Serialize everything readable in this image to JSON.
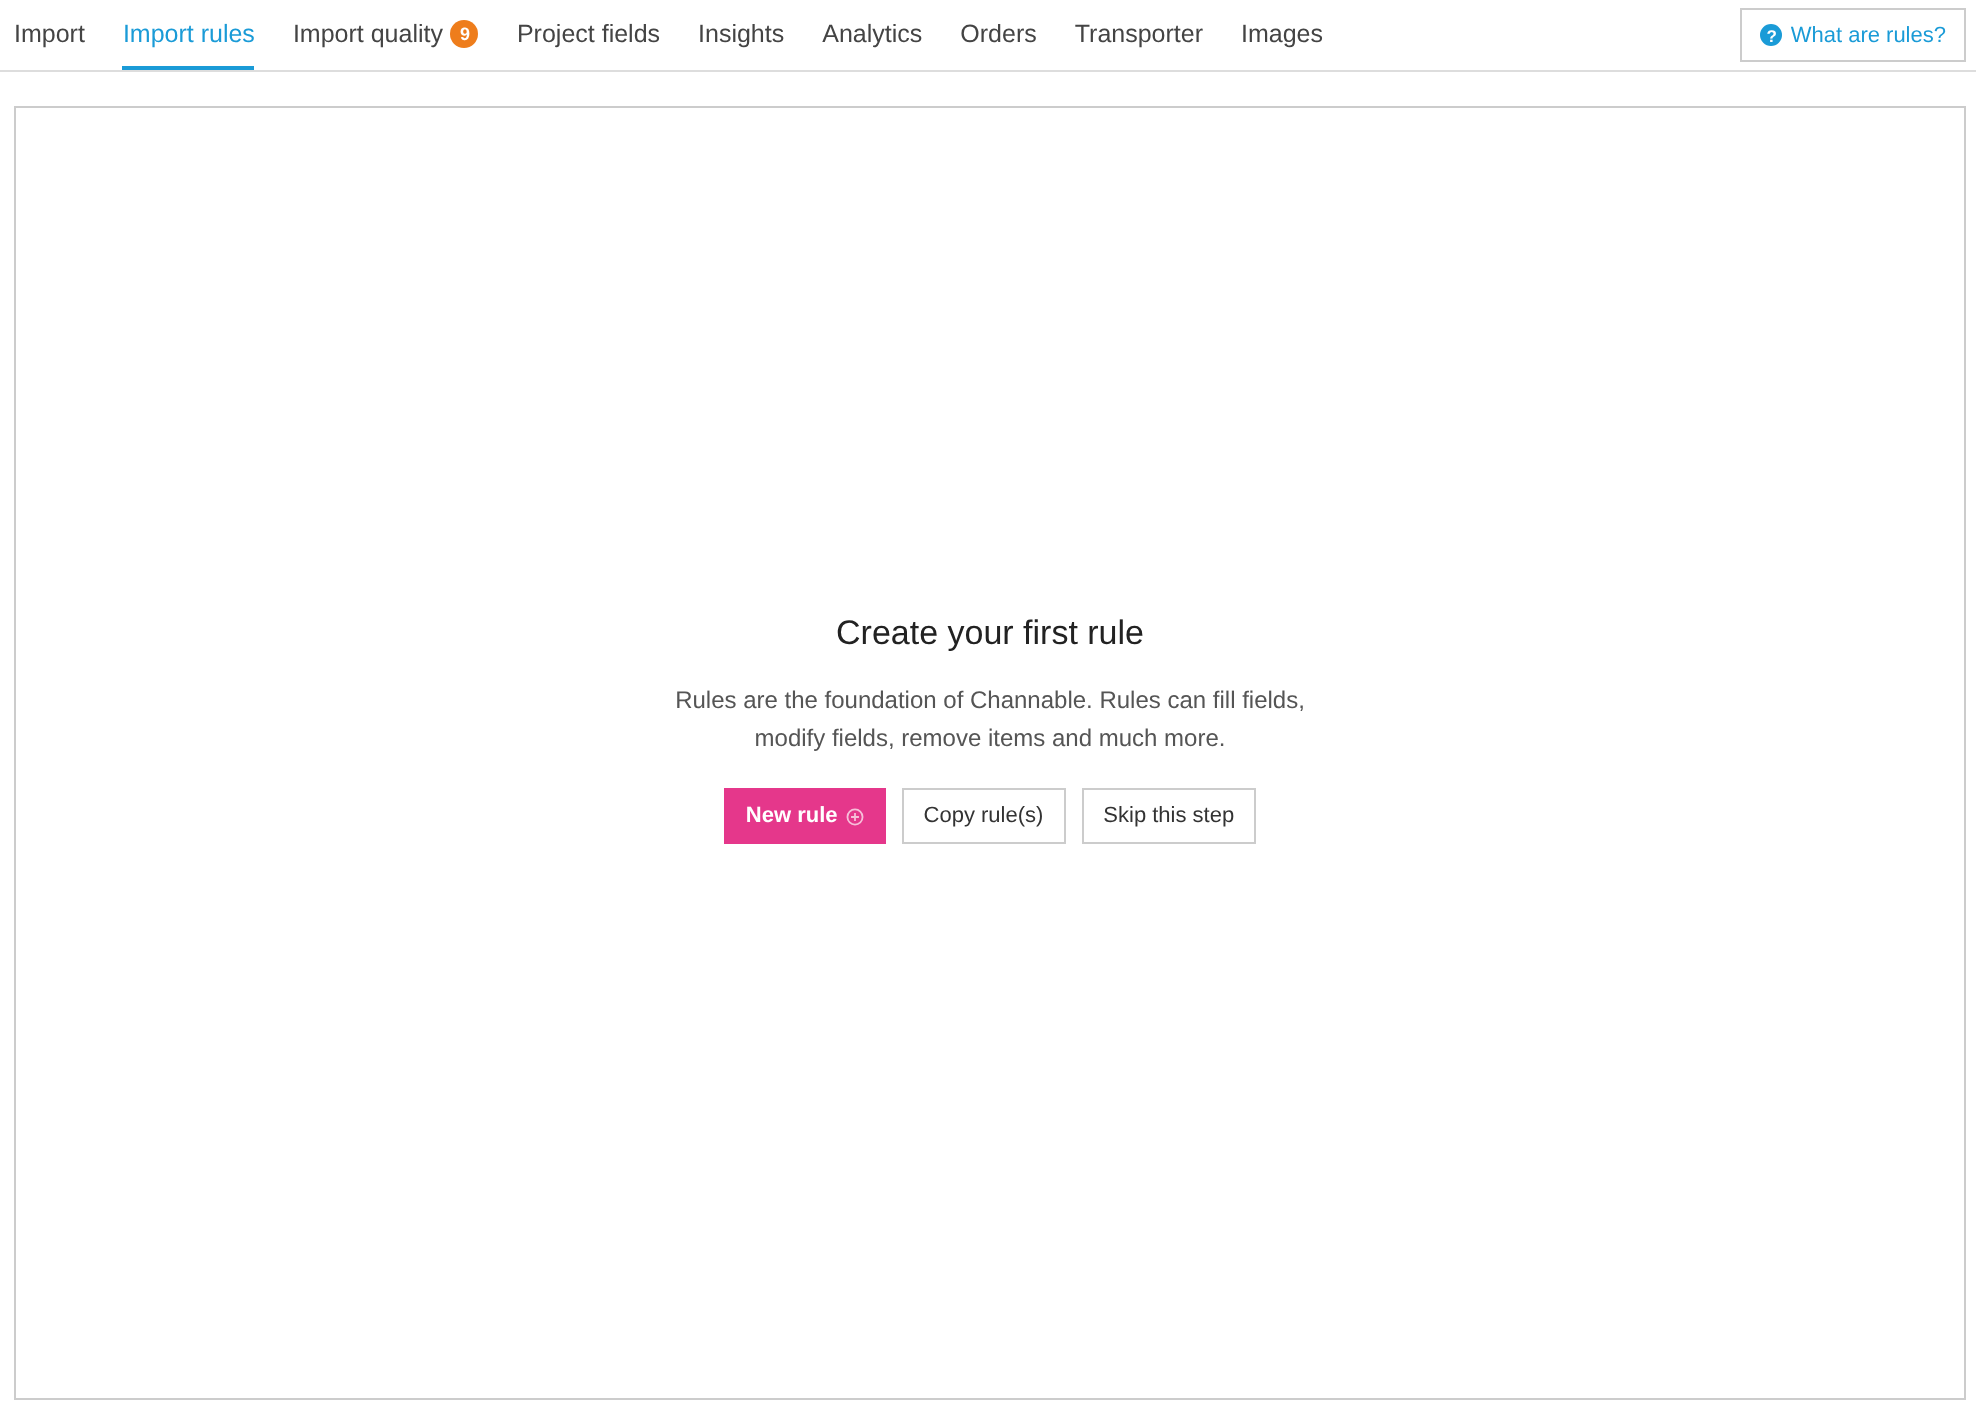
{
  "tabs": [
    {
      "label": "Import",
      "selected": false
    },
    {
      "label": "Import rules",
      "selected": true
    },
    {
      "label": "Import quality",
      "selected": false,
      "badge": "9"
    },
    {
      "label": "Project fields",
      "selected": false
    },
    {
      "label": "Insights",
      "selected": false
    },
    {
      "label": "Analytics",
      "selected": false
    },
    {
      "label": "Orders",
      "selected": false
    },
    {
      "label": "Transporter",
      "selected": false
    },
    {
      "label": "Images",
      "selected": false
    }
  ],
  "help_button": {
    "icon": "?",
    "label": "What are rules?"
  },
  "empty_state": {
    "title": "Create your first rule",
    "description": "Rules are the foundation of Channable. Rules can fill fields, modify fields, remove items and much more.",
    "buttons": [
      {
        "label": "New rule",
        "kind": "primary"
      },
      {
        "label": "Copy rule(s)",
        "kind": "secondary"
      },
      {
        "label": "Skip this step",
        "kind": "secondary"
      }
    ]
  }
}
